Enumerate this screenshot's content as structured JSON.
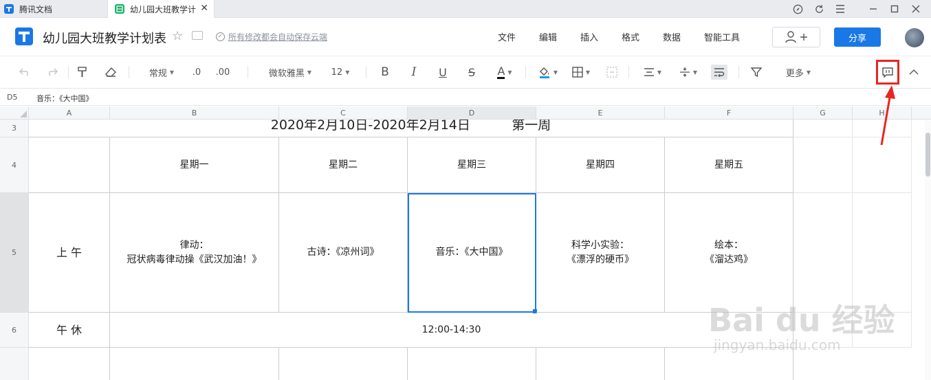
{
  "tabs": [
    {
      "label": "腾讯文档"
    },
    {
      "label": "幼儿园大班教学计"
    }
  ],
  "header": {
    "doc_title": "幼儿园大班教学计划表",
    "save_status": "所有修改都会自动保存云端",
    "menu": [
      "文件",
      "编辑",
      "插入",
      "格式",
      "数据",
      "智能工具"
    ],
    "share_label": "分享"
  },
  "toolbar": {
    "number_format": "常规",
    "decrease_decimal": ".0",
    "increase_decimal": ".00",
    "font_family": "微软雅黑",
    "font_size": "12",
    "bold": "B",
    "italic": "I",
    "underline": "U",
    "strike": "S",
    "font_color": "A",
    "more": "更多"
  },
  "formula_bar": {
    "cell_ref": "D5",
    "value": "音乐：《大中国》"
  },
  "columns": [
    "A",
    "B",
    "C",
    "D",
    "E",
    "F",
    "G",
    "H"
  ],
  "rows": [
    "3",
    "4",
    "5",
    "6"
  ],
  "sheet": {
    "title_row": "2020年2月10日-2020年2月14日          第一周",
    "weekdays": [
      "星期一",
      "星期二",
      "星期三",
      "星期四",
      "星期五"
    ],
    "morning_label": "上 午",
    "morning": [
      "律动：\n冠状病毒律动操《武汉加油！》",
      "古诗：《凉州词》",
      "音乐：《大中国》",
      "科学小实验：\n《漂浮的硬币》",
      "绘本：\n《溜达鸡》"
    ],
    "nap_label": "午 休",
    "nap_time": "12:00-14:30"
  },
  "watermark": {
    "main": "Bai du 经验",
    "sub": "jingyan.baidu.com"
  },
  "colors": {
    "accent": "#1a78e6",
    "highlight": "#e8261f"
  }
}
